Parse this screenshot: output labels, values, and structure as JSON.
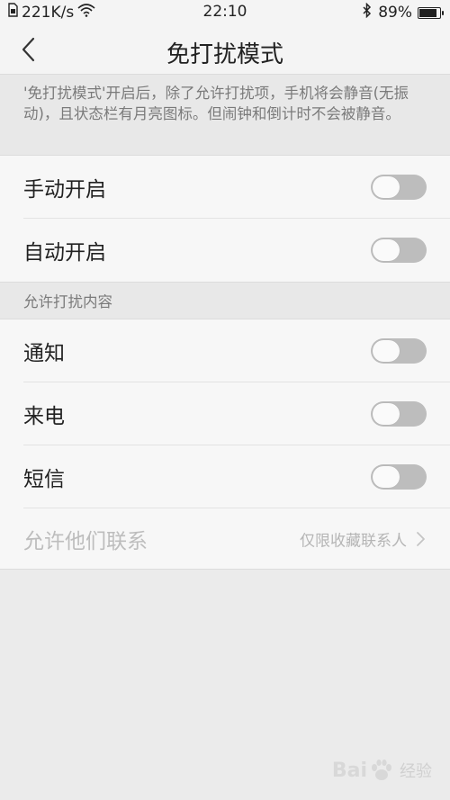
{
  "status_bar": {
    "speed": "221K/s",
    "time": "22:10",
    "battery": "89%",
    "battery_level": 0.89,
    "icons": [
      "sim-icon",
      "wifi-icon",
      "bluetooth-icon",
      "battery-icon"
    ]
  },
  "header": {
    "title": "免打扰模式",
    "back_icon": "chevron-left-icon"
  },
  "description": "'免打扰模式'开启后，除了允许打扰项，手机将会静音(无振动)，且状态栏有月亮图标。但闹钟和倒计时不会被静音。",
  "settings": {
    "manual": {
      "label": "手动开启",
      "enabled": false
    },
    "auto": {
      "label": "自动开启",
      "enabled": false
    }
  },
  "allow_section": {
    "header": "允许打扰内容",
    "notifications": {
      "label": "通知",
      "enabled": false
    },
    "calls": {
      "label": "来电",
      "enabled": false
    },
    "sms": {
      "label": "短信",
      "enabled": false
    },
    "contacts": {
      "label": "允许他们联系",
      "value": "仅限收藏联系人"
    }
  },
  "watermark": {
    "brand": "Bai",
    "suffix": "经验"
  },
  "colors": {
    "toggle_off": "#bdbdbd",
    "background": "#ebebeb",
    "row_background": "#f7f7f7"
  }
}
